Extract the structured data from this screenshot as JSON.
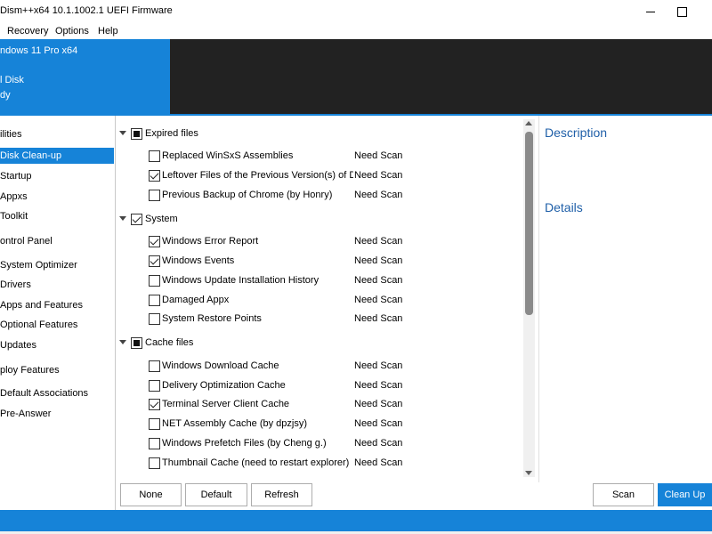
{
  "window": {
    "title": "Dism++x64 10.1.1002.1 UEFI Firmware"
  },
  "menu": {
    "items": [
      "Recovery",
      "Options",
      "Help"
    ]
  },
  "header": {
    "os_name": "ndows 11 Pro x64",
    "disk_name": "l Disk",
    "disk_status": "dy"
  },
  "sidebar": {
    "items": [
      {
        "label": "ilities",
        "selected": false
      },
      {
        "label": "Disk Clean-up",
        "selected": true
      },
      {
        "label": "Startup",
        "selected": false
      },
      {
        "label": "Appxs",
        "selected": false
      },
      {
        "label": "Toolkit",
        "selected": false
      },
      {
        "label": "ontrol Panel",
        "selected": false
      },
      {
        "label": "System Optimizer",
        "selected": false
      },
      {
        "label": "Drivers",
        "selected": false
      },
      {
        "label": "Apps and Features",
        "selected": false
      },
      {
        "label": "Optional Features",
        "selected": false
      },
      {
        "label": "Updates",
        "selected": false
      },
      {
        "label": "ploy Features",
        "selected": false
      },
      {
        "label": "Default Associations",
        "selected": false
      },
      {
        "label": "Pre-Answer",
        "selected": false
      }
    ]
  },
  "cleanup": {
    "groups": [
      {
        "label": "Expired files",
        "state": "indeterminate",
        "items": [
          {
            "label": "Replaced WinSxS Assemblies",
            "checked": false,
            "status": "Need Scan"
          },
          {
            "label": "Leftover Files of the Previous Version(s) of Dism",
            "checked": true,
            "status": "Need Scan"
          },
          {
            "label": "Previous Backup of Chrome (by Honry)",
            "checked": false,
            "status": "Need Scan"
          }
        ]
      },
      {
        "label": "System",
        "state": "checked",
        "items": [
          {
            "label": "Windows Error Report",
            "checked": true,
            "status": "Need Scan"
          },
          {
            "label": "Windows Events",
            "checked": true,
            "status": "Need Scan"
          },
          {
            "label": "Windows Update Installation History",
            "checked": false,
            "status": "Need Scan"
          },
          {
            "label": "Damaged Appx",
            "checked": false,
            "status": "Need Scan"
          },
          {
            "label": "System Restore Points",
            "checked": false,
            "status": "Need Scan"
          }
        ]
      },
      {
        "label": "Cache files",
        "state": "indeterminate",
        "items": [
          {
            "label": "Windows Download Cache",
            "checked": false,
            "status": "Need Scan"
          },
          {
            "label": "Delivery Optimization Cache",
            "checked": false,
            "status": "Need Scan"
          },
          {
            "label": "Terminal Server Client Cache",
            "checked": true,
            "status": "Need Scan"
          },
          {
            "label": "NET Assembly Cache (by dpzjsy)",
            "checked": false,
            "status": "Need Scan"
          },
          {
            "label": "Windows Prefetch Files (by Cheng g.)",
            "checked": false,
            "status": "Need Scan"
          },
          {
            "label": "Thumbnail Cache (need to restart explorer)",
            "checked": false,
            "status": "Need Scan"
          }
        ]
      }
    ]
  },
  "panel": {
    "description_heading": "Description",
    "details_heading": "Details"
  },
  "buttons": {
    "none": "None",
    "default": "Default",
    "refresh": "Refresh",
    "scan": "Scan",
    "clean_up": "Clean Up"
  },
  "colors": {
    "accent": "#1683d8",
    "header_dark": "#222222",
    "heading_text": "#1f5fa8"
  }
}
